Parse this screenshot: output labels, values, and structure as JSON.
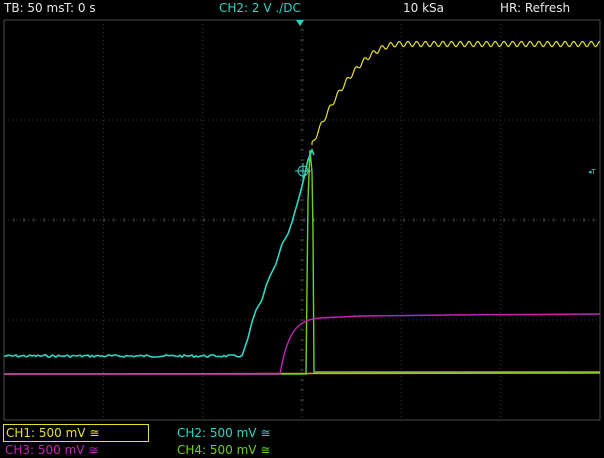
{
  "header": {
    "timebase": "TB: 50 ms",
    "trigger_time": "T: 0 s",
    "channel_setting": "CH2: 2 V ./DC",
    "sample_rate": "10 kSa",
    "hr_mode": "HR: Refresh"
  },
  "channels": [
    {
      "label": "CH1: 500 mV ≅",
      "color": "#e6e02a",
      "selected": true
    },
    {
      "label": "CH2: 500 mV ≅",
      "color": "#2fd6c6",
      "selected": false
    },
    {
      "label": "CH3: 500 mV ≅",
      "color": "#c225b8",
      "selected": false
    },
    {
      "label": "CH4: 500 mV ≅",
      "color": "#6bd31c",
      "selected": false
    }
  ],
  "trigger_level_label": "◂T",
  "colors": {
    "background": "#000000",
    "grid": "#3a3a3a",
    "ch1": "#e6e02a",
    "ch2": "#2fd6c6",
    "ch3": "#c225b8",
    "ch4": "#6bd31c",
    "trace_orange": "#e8a040"
  }
}
